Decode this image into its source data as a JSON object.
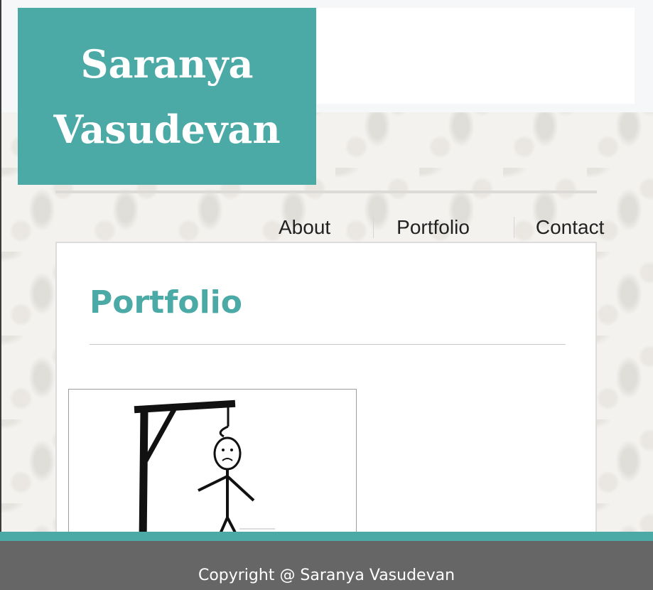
{
  "site": {
    "name_line1": "Saranya",
    "name_line2": "Vasudevan",
    "brand_color": "#4ba9a6"
  },
  "nav": {
    "items": [
      {
        "label": "About"
      },
      {
        "label": "Portfolio"
      },
      {
        "label": "Contact"
      }
    ]
  },
  "main": {
    "title": "Portfolio",
    "project_image": "hangman-icon"
  },
  "footer": {
    "text": "Copyright @ Saranya Vasudevan"
  }
}
